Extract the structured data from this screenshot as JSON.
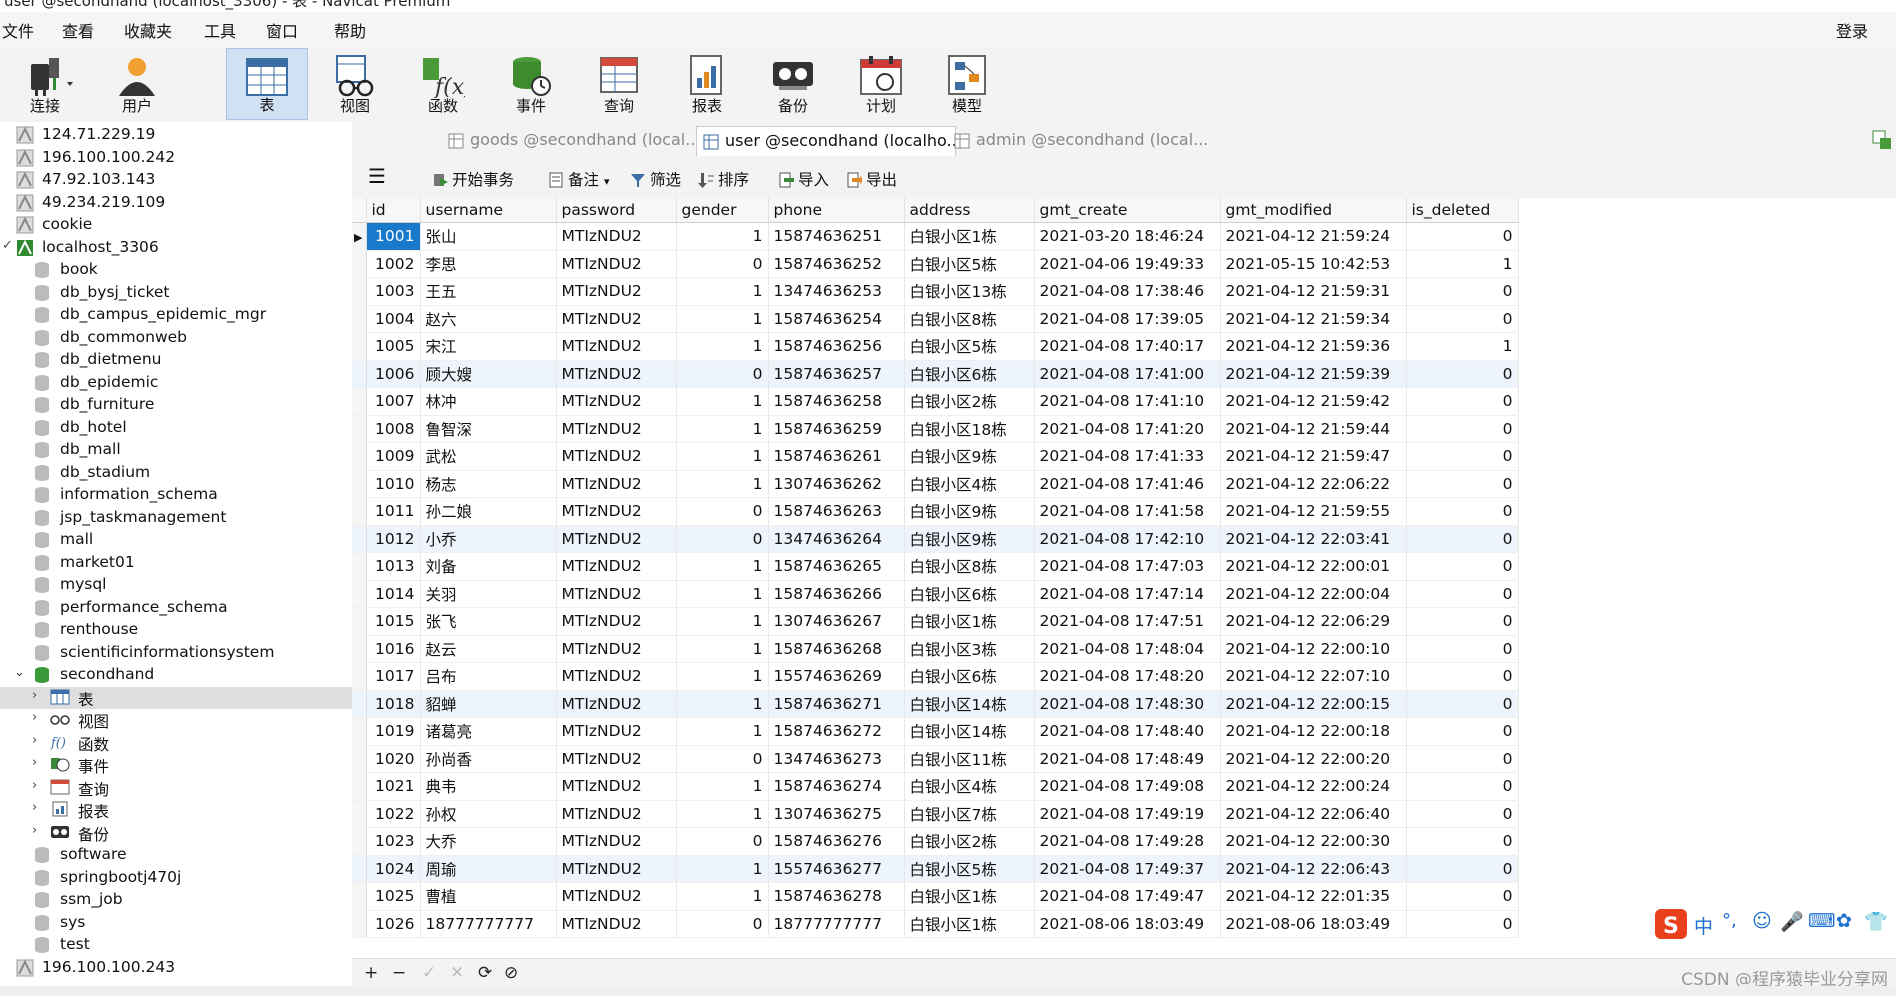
{
  "window": {
    "title": "user @secondhand (localhost_3306) - 表 - Navicat Premium"
  },
  "menu": [
    "文件",
    "查看",
    "收藏夹",
    "工具",
    "窗口",
    "帮助"
  ],
  "login_label": "登录",
  "toolbar": [
    {
      "label": "连接",
      "icon": "plug-icon"
    },
    {
      "label": "用户",
      "icon": "user-icon"
    },
    {
      "label": "表",
      "icon": "table-icon"
    },
    {
      "label": "视图",
      "icon": "view-icon"
    },
    {
      "label": "函数",
      "icon": "function-icon"
    },
    {
      "label": "事件",
      "icon": "event-icon"
    },
    {
      "label": "查询",
      "icon": "query-icon"
    },
    {
      "label": "报表",
      "icon": "report-icon"
    },
    {
      "label": "备份",
      "icon": "backup-icon"
    },
    {
      "label": "计划",
      "icon": "schedule-icon"
    },
    {
      "label": "模型",
      "icon": "model-icon"
    }
  ],
  "sidebar": {
    "items": [
      {
        "label": "124.71.229.19",
        "type": "conn"
      },
      {
        "label": "196.100.100.242",
        "type": "conn"
      },
      {
        "label": "47.92.103.143",
        "type": "conn"
      },
      {
        "label": "49.234.219.109",
        "type": "conn"
      },
      {
        "label": "cookie",
        "type": "conn"
      },
      {
        "label": "localhost_3306",
        "type": "conn-open"
      },
      {
        "label": "book",
        "type": "db"
      },
      {
        "label": "db_bysj_ticket",
        "type": "db"
      },
      {
        "label": "db_campus_epidemic_mgr",
        "type": "db"
      },
      {
        "label": "db_commonweb",
        "type": "db"
      },
      {
        "label": "db_dietmenu",
        "type": "db"
      },
      {
        "label": "db_epidemic",
        "type": "db"
      },
      {
        "label": "db_furniture",
        "type": "db"
      },
      {
        "label": "db_hotel",
        "type": "db"
      },
      {
        "label": "db_mall",
        "type": "db"
      },
      {
        "label": "db_stadium",
        "type": "db"
      },
      {
        "label": "information_schema",
        "type": "db"
      },
      {
        "label": "jsp_taskmanagement",
        "type": "db"
      },
      {
        "label": "mall",
        "type": "db"
      },
      {
        "label": "market01",
        "type": "db"
      },
      {
        "label": "mysql",
        "type": "db"
      },
      {
        "label": "performance_schema",
        "type": "db"
      },
      {
        "label": "renthouse",
        "type": "db"
      },
      {
        "label": "scientificinformationsystem",
        "type": "db"
      },
      {
        "label": "secondhand",
        "type": "db-open"
      },
      {
        "label": "表",
        "type": "sub-table"
      },
      {
        "label": "视图",
        "type": "sub-view"
      },
      {
        "label": "函数",
        "type": "sub-func"
      },
      {
        "label": "事件",
        "type": "sub-event"
      },
      {
        "label": "查询",
        "type": "sub-query"
      },
      {
        "label": "报表",
        "type": "sub-report"
      },
      {
        "label": "备份",
        "type": "sub-backup"
      },
      {
        "label": "software",
        "type": "db"
      },
      {
        "label": "springbootj470j",
        "type": "db"
      },
      {
        "label": "ssm_job",
        "type": "db"
      },
      {
        "label": "sys",
        "type": "db"
      },
      {
        "label": "test",
        "type": "db"
      },
      {
        "label": "196.100.100.243",
        "type": "conn"
      }
    ]
  },
  "tabs": [
    {
      "label": "goods @secondhand (local...",
      "active": false
    },
    {
      "label": "user @secondhand (localho...",
      "active": true
    },
    {
      "label": "admin @secondhand (local...",
      "active": false
    }
  ],
  "actions": [
    "开始事务",
    "备注",
    "筛选",
    "排序",
    "导入",
    "导出"
  ],
  "table": {
    "columns": [
      "id",
      "username",
      "password",
      "gender",
      "phone",
      "address",
      "gmt_create",
      "gmt_modified",
      "is_deleted"
    ],
    "rows": [
      [
        "1001",
        "张山",
        "MTIzNDU2",
        "1",
        "15874636251",
        "白银小区1栋",
        "2021-03-20 18:46:24",
        "2021-04-12 21:59:24",
        "0"
      ],
      [
        "1002",
        "李思",
        "MTIzNDU2",
        "0",
        "15874636252",
        "白银小区5栋",
        "2021-04-06 19:49:33",
        "2021-05-15 10:42:53",
        "1"
      ],
      [
        "1003",
        "王五",
        "MTIzNDU2",
        "1",
        "13474636253",
        "白银小区13栋",
        "2021-04-08 17:38:46",
        "2021-04-12 21:59:31",
        "0"
      ],
      [
        "1004",
        "赵六",
        "MTIzNDU2",
        "1",
        "15874636254",
        "白银小区8栋",
        "2021-04-08 17:39:05",
        "2021-04-12 21:59:34",
        "0"
      ],
      [
        "1005",
        "宋江",
        "MTIzNDU2",
        "1",
        "15874636256",
        "白银小区5栋",
        "2021-04-08 17:40:17",
        "2021-04-12 21:59:36",
        "1"
      ],
      [
        "1006",
        "顾大嫂",
        "MTIzNDU2",
        "0",
        "15874636257",
        "白银小区6栋",
        "2021-04-08 17:41:00",
        "2021-04-12 21:59:39",
        "0"
      ],
      [
        "1007",
        "林冲",
        "MTIzNDU2",
        "1",
        "15874636258",
        "白银小区2栋",
        "2021-04-08 17:41:10",
        "2021-04-12 21:59:42",
        "0"
      ],
      [
        "1008",
        "鲁智深",
        "MTIzNDU2",
        "1",
        "15874636259",
        "白银小区18栋",
        "2021-04-08 17:41:20",
        "2021-04-12 21:59:44",
        "0"
      ],
      [
        "1009",
        "武松",
        "MTIzNDU2",
        "1",
        "15874636261",
        "白银小区9栋",
        "2021-04-08 17:41:33",
        "2021-04-12 21:59:47",
        "0"
      ],
      [
        "1010",
        "杨志",
        "MTIzNDU2",
        "1",
        "13074636262",
        "白银小区4栋",
        "2021-04-08 17:41:46",
        "2021-04-12 22:06:22",
        "0"
      ],
      [
        "1011",
        "孙二娘",
        "MTIzNDU2",
        "0",
        "15874636263",
        "白银小区9栋",
        "2021-04-08 17:41:58",
        "2021-04-12 21:59:55",
        "0"
      ],
      [
        "1012",
        "小乔",
        "MTIzNDU2",
        "0",
        "13474636264",
        "白银小区9栋",
        "2021-04-08 17:42:10",
        "2021-04-12 22:03:41",
        "0"
      ],
      [
        "1013",
        "刘备",
        "MTIzNDU2",
        "1",
        "15874636265",
        "白银小区8栋",
        "2021-04-08 17:47:03",
        "2021-04-12 22:00:01",
        "0"
      ],
      [
        "1014",
        "关羽",
        "MTIzNDU2",
        "1",
        "15874636266",
        "白银小区6栋",
        "2021-04-08 17:47:14",
        "2021-04-12 22:00:04",
        "0"
      ],
      [
        "1015",
        "张飞",
        "MTIzNDU2",
        "1",
        "13074636267",
        "白银小区1栋",
        "2021-04-08 17:47:51",
        "2021-04-12 22:06:29",
        "0"
      ],
      [
        "1016",
        "赵云",
        "MTIzNDU2",
        "1",
        "15874636268",
        "白银小区3栋",
        "2021-04-08 17:48:04",
        "2021-04-12 22:00:10",
        "0"
      ],
      [
        "1017",
        "吕布",
        "MTIzNDU2",
        "1",
        "15574636269",
        "白银小区6栋",
        "2021-04-08 17:48:20",
        "2021-04-12 22:07:10",
        "0"
      ],
      [
        "1018",
        "貂蝉",
        "MTIzNDU2",
        "1",
        "15874636271",
        "白银小区14栋",
        "2021-04-08 17:48:30",
        "2021-04-12 22:00:15",
        "0"
      ],
      [
        "1019",
        "诸葛亮",
        "MTIzNDU2",
        "1",
        "15874636272",
        "白银小区14栋",
        "2021-04-08 17:48:40",
        "2021-04-12 22:00:18",
        "0"
      ],
      [
        "1020",
        "孙尚香",
        "MTIzNDU2",
        "0",
        "13474636273",
        "白银小区11栋",
        "2021-04-08 17:48:49",
        "2021-04-12 22:00:20",
        "0"
      ],
      [
        "1021",
        "典韦",
        "MTIzNDU2",
        "1",
        "15874636274",
        "白银小区4栋",
        "2021-04-08 17:49:08",
        "2021-04-12 22:00:24",
        "0"
      ],
      [
        "1022",
        "孙权",
        "MTIzNDU2",
        "1",
        "13074636275",
        "白银小区7栋",
        "2021-04-08 17:49:19",
        "2021-04-12 22:06:40",
        "0"
      ],
      [
        "1023",
        "大乔",
        "MTIzNDU2",
        "0",
        "15874636276",
        "白银小区2栋",
        "2021-04-08 17:49:28",
        "2021-04-12 22:00:30",
        "0"
      ],
      [
        "1024",
        "周瑜",
        "MTIzNDU2",
        "1",
        "15574636277",
        "白银小区5栋",
        "2021-04-08 17:49:37",
        "2021-04-12 22:06:43",
        "0"
      ],
      [
        "1025",
        "曹植",
        "MTIzNDU2",
        "1",
        "15874636278",
        "白银小区1栋",
        "2021-04-08 17:49:47",
        "2021-04-12 22:01:35",
        "0"
      ],
      [
        "1026",
        "18777777777",
        "MTIzNDU2",
        "0",
        "18777777777",
        "白银小区1栋",
        "2021-08-06 18:03:49",
        "2021-08-06 18:03:49",
        "0"
      ]
    ]
  },
  "bottom_controls": [
    "+",
    "−",
    "✓",
    "✕",
    "⟳",
    "⊘"
  ],
  "watermark": "CSDN @程序猿毕业分享网",
  "ime": {
    "label": "中"
  },
  "colors": {
    "selected_cell": "#1979ca",
    "alt_row": "#eef4fb",
    "active_tool": "#cfe1f3"
  }
}
